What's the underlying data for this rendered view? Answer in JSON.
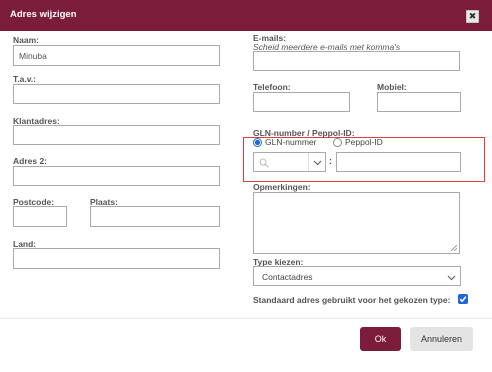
{
  "dialog": {
    "title": "Adres wijzigen",
    "close_symbol": "✖"
  },
  "fields": {
    "naam": {
      "label": "Naam:",
      "value": "Minuba"
    },
    "tav": {
      "label": "T.a.v.:",
      "value": ""
    },
    "klantadres": {
      "label": "Klantadres:",
      "value": ""
    },
    "adres2": {
      "label": "Adres 2:",
      "value": ""
    },
    "postcode": {
      "label": "Postcode:",
      "value": ""
    },
    "plaats": {
      "label": "Plaats:",
      "value": ""
    },
    "land": {
      "label": "Land:",
      "value": ""
    },
    "emails": {
      "label": "E-mails:",
      "hint": "Scheid meerdere e-mails met komma's",
      "value": ""
    },
    "telefoon": {
      "label": "Telefoon:",
      "value": ""
    },
    "mobiel": {
      "label": "Mobiel:",
      "value": ""
    },
    "opmerkingen": {
      "label": "Opmerkingen:",
      "value": ""
    }
  },
  "gln": {
    "label": "GLN-number / Peppol-ID:",
    "option_gln": "GLN-nummer",
    "option_peppol": "Peppol-ID",
    "selected": "GLN-nummer",
    "separator": ":",
    "value": ""
  },
  "type": {
    "label": "Type kiezen:",
    "selected": "Contactadres"
  },
  "standaard": {
    "label": "Standaard adres gebruikt voor het gekozen type:",
    "checked": true
  },
  "buttons": {
    "ok": "Ok",
    "cancel": "Annuleren"
  }
}
